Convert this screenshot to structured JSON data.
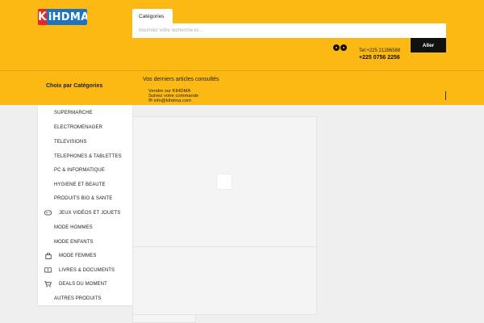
{
  "header": {
    "logo_k": "K",
    "logo_text": "iHDMA",
    "category_tab": "Catégories",
    "search_placeholder": "Inscrivez votre recherche ici...",
    "search_button": "Aller",
    "phone_line1": "Tel:+225 21286588",
    "phone_line2": "+225 0756 2256"
  },
  "nav": {
    "choose_category": "Choix par Catégories",
    "recent_title": "Vos derniers articles consultés",
    "links": [
      "Vendre sur KIHDMA",
      "Suivez votre commande",
      "✉ info@kihdma.com"
    ]
  },
  "categories": [
    {
      "label": "Supermarche",
      "icon": ""
    },
    {
      "label": "Electromenager",
      "icon": ""
    },
    {
      "label": "Televisions",
      "icon": ""
    },
    {
      "label": "Telephones & Tablettes",
      "icon": ""
    },
    {
      "label": "PC & Informatique",
      "icon": ""
    },
    {
      "label": "Hygiene et beaute",
      "icon": ""
    },
    {
      "label": "Produits bio & sante",
      "icon": ""
    },
    {
      "label": "Jeux vidéos et jouets",
      "icon": "gamepad-icon"
    },
    {
      "label": "Mode Hommes",
      "icon": ""
    },
    {
      "label": "Mode enfants",
      "icon": ""
    },
    {
      "label": "Mode femmes",
      "icon": "shopping-bag-icon"
    },
    {
      "label": "Livres & Documents",
      "icon": "book-icon"
    },
    {
      "label": "Deals du moment",
      "icon": "cart-icon"
    },
    {
      "label": "Autres produits",
      "icon": ""
    }
  ],
  "colors": {
    "brand_yellow": "#fdb913",
    "logo_blue": "#1e73be",
    "logo_red": "#e02a2a"
  }
}
